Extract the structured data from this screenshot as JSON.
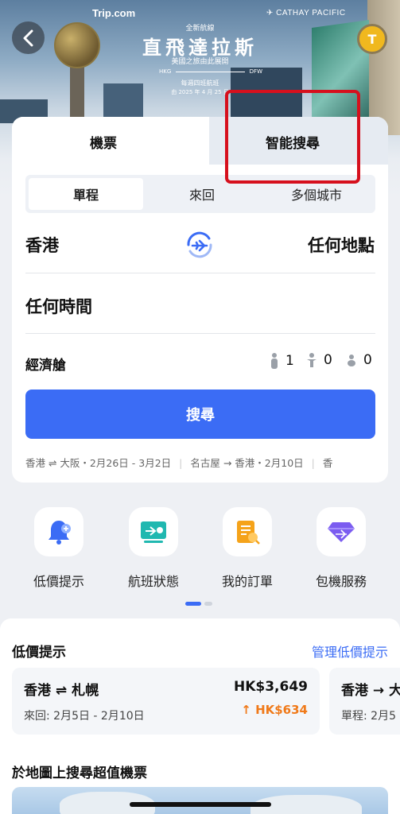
{
  "banner": {
    "brand_left": "Trip.com",
    "brand_right": "CATHAY PACIFIC",
    "promo_sub": "全新航線",
    "promo_title": "直飛達拉斯",
    "promo_tagline": "美國之旅由此展開",
    "route_from": "HKG",
    "route_to": "DFW",
    "frequency": "每週四班航班",
    "start_date": "由 2025 年 4 月 25 日",
    "back_icon": "chevron-left-icon",
    "avatar_letter": "T",
    "accent_avatar": "#f0b81e"
  },
  "tabs": {
    "flights": "機票",
    "smart_search": "智能搜尋"
  },
  "trip_type": {
    "one_way": "單程",
    "round_trip": "來回",
    "multi_city": "多個城市"
  },
  "search": {
    "origin": "香港",
    "destination": "任何地點",
    "date": "任何時間",
    "cabin": "經濟艙",
    "adults": "1",
    "children": "0",
    "infants": "0",
    "button": "搜尋"
  },
  "history": [
    "香港 ⇌ 大阪・2月26日 - 3月2日",
    "名古屋 → 香港・2月10日",
    "香"
  ],
  "quick_actions": [
    {
      "label": "低價提示",
      "icon": "bell-plus-icon"
    },
    {
      "label": "航班狀態",
      "icon": "flight-status-icon"
    },
    {
      "label": "我的訂單",
      "icon": "order-icon"
    },
    {
      "label": "包機服務",
      "icon": "charter-diamond-icon"
    }
  ],
  "alerts": {
    "title": "低價提示",
    "manage": "管理低價提示",
    "cards": [
      {
        "route": "香港 ⇌ 札幌",
        "dates": "來回: 2月5日 - 2月10日",
        "price": "HK$3,649",
        "drop": "HK$634"
      },
      {
        "route": "香港 → 大",
        "dates": "單程: 2月5",
        "price": "",
        "drop": ""
      }
    ],
    "map_title": "於地圖上搜尋超值機票"
  },
  "colors": {
    "primary": "#3b6cf5",
    "highlight": "#d6101d",
    "price_drop": "#f07a1a"
  }
}
